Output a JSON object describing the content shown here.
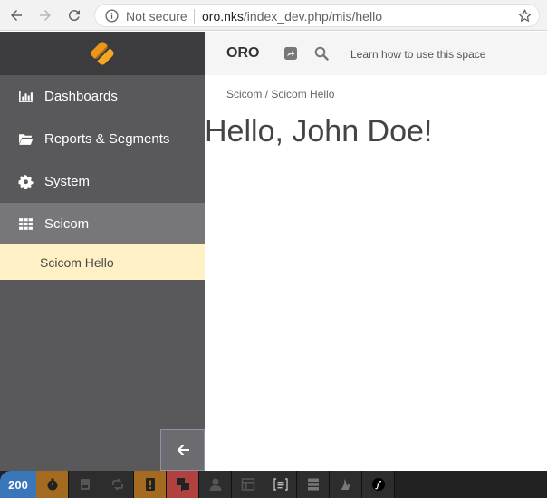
{
  "browser": {
    "security_label": "Not secure",
    "url_host": "oro.nks",
    "url_path": "/index_dev.php/mis/hello"
  },
  "header": {
    "brand": "ORO",
    "learn_link": "Learn how to use this space"
  },
  "sidebar": {
    "items": [
      {
        "label": "Dashboards",
        "icon": "bar-chart-icon"
      },
      {
        "label": "Reports & Segments",
        "icon": "folder-open-icon"
      },
      {
        "label": "System",
        "icon": "gear-icon"
      },
      {
        "label": "Scicom",
        "icon": "grid-icon"
      }
    ],
    "submenu": {
      "label": "Scicom Hello"
    }
  },
  "breadcrumb": {
    "parent": "Scicom",
    "separator": "/",
    "current": "Scicom Hello"
  },
  "page": {
    "title": "Hello, John Doe!"
  },
  "debug_toolbar": {
    "status_code": "200",
    "colors": {
      "status": "#3a77ba",
      "warning": "#a46a1f",
      "error": "#b0413e"
    }
  }
}
